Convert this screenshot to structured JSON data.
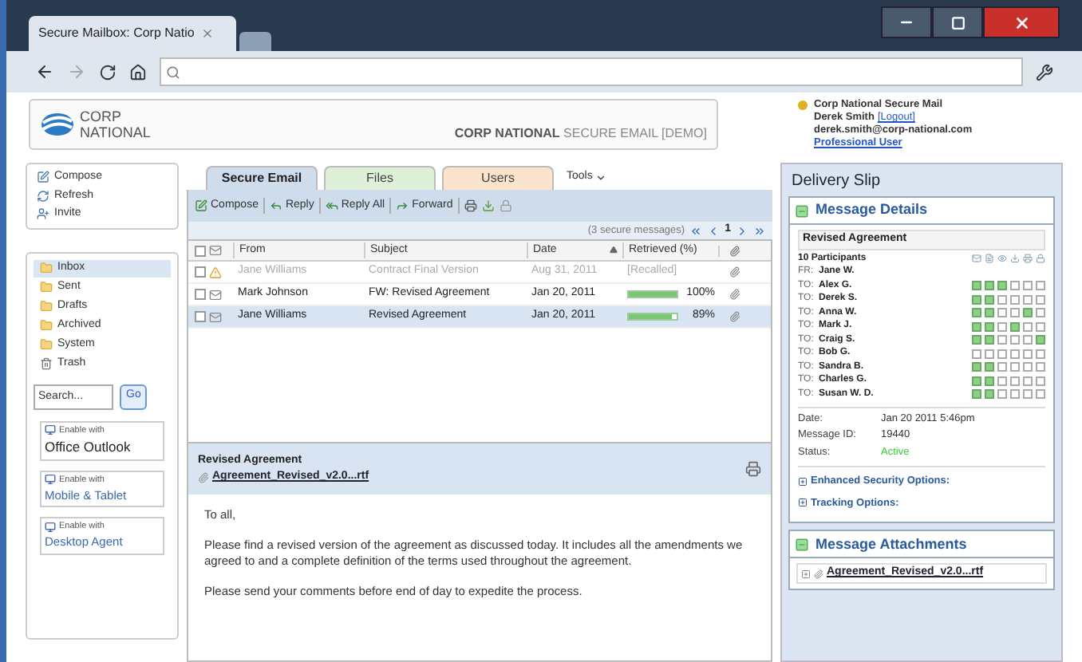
{
  "browser": {
    "tab_title": "Secure Mailbox: Corp Natio"
  },
  "header": {
    "logo_line1": "CORP",
    "logo_line2": "NATIONAL",
    "product_bold": "CORP NATIONAL",
    "product_rest": "SECURE EMAIL [DEMO]",
    "service": "Corp National Secure Mail",
    "user": "Derek Smith",
    "logout": "[Logout]",
    "email": "derek.smith@corp-national.com",
    "plan": "Professional User"
  },
  "actions": [
    {
      "label": "Compose"
    },
    {
      "label": "Refresh"
    },
    {
      "label": "Invite"
    }
  ],
  "folders": [
    {
      "label": "Inbox",
      "selected": true
    },
    {
      "label": "Sent",
      "selected": false
    },
    {
      "label": "Drafts",
      "selected": false
    },
    {
      "label": "Archived",
      "selected": false
    },
    {
      "label": "System",
      "selected": false
    },
    {
      "label": "Trash",
      "selected": false
    }
  ],
  "search": {
    "placeholder": "Search...",
    "button": "Go"
  },
  "enable_badges": [
    {
      "caption": "Enable with",
      "product": "Office Outlook"
    },
    {
      "caption": "Enable with",
      "product": "Mobile & Tablet"
    },
    {
      "caption": "Enable with",
      "product": "Desktop Agent"
    }
  ],
  "tabs": [
    {
      "label": "Secure Email",
      "selected": true
    },
    {
      "label": "Files",
      "selected": false
    },
    {
      "label": "Users",
      "selected": false
    }
  ],
  "tools_menu": "Tools",
  "toolbar": [
    "Compose",
    "Reply",
    "Reply All",
    "Forward"
  ],
  "pager": {
    "summary": "(3 secure messages)",
    "page": "1"
  },
  "table": {
    "select_all_checked": false,
    "columns": [
      "From",
      "Subject",
      "Date",
      "Retrieved (%)"
    ],
    "rows": [
      {
        "from": "Jane Williams",
        "subject": "Contract Final Version",
        "date": "Aug 31, 2011",
        "kind": "recalled",
        "retrieved": "[Recalled]",
        "checked": false,
        "selected": false
      },
      {
        "from": "Mark Johnson",
        "subject": "FW: Revised Agreement",
        "date": "Jan 20, 2011",
        "kind": "progress",
        "level": 1,
        "retrieved": "100%",
        "checked": false,
        "selected": false
      },
      {
        "from": "Jane Williams",
        "subject": "Revised Agreement",
        "date": "Jan 20, 2011",
        "kind": "progress",
        "level": 0.89,
        "retrieved": "89%",
        "checked": false,
        "selected": true
      }
    ]
  },
  "preview": {
    "subject": "Revised Agreement",
    "attachment": "Agreement_Revised_v2.0...rtf",
    "paragraphs": [
      "To all,",
      "Please find a revised version of the agreement as discussed today. It includes all the amendments we agreed to and a complete definition of the terms used throughout the agreement.",
      "Please send your comments before end of day to expedite the process."
    ]
  },
  "delivery_slip": {
    "title": "Delivery Slip",
    "details_title": "Message Details",
    "subject": "Revised Agreement",
    "participants_count": "10 Participants",
    "participants": [
      {
        "role": "FR:",
        "name": "Jane W."
      },
      {
        "role": "TO:",
        "name": "Alex G.",
        "checks": [
          true,
          true,
          true,
          false,
          false,
          false
        ]
      },
      {
        "role": "TO:",
        "name": "Derek S.",
        "checks": [
          true,
          true,
          false,
          false,
          false,
          false
        ]
      },
      {
        "role": "TO:",
        "name": "Anna W.",
        "checks": [
          true,
          true,
          false,
          false,
          true,
          false
        ]
      },
      {
        "role": "TO:",
        "name": "Mark J.",
        "checks": [
          true,
          true,
          false,
          true,
          false,
          false
        ]
      },
      {
        "role": "TO:",
        "name": "Craig S.",
        "checks": [
          true,
          true,
          false,
          false,
          false,
          true
        ]
      },
      {
        "role": "TO:",
        "name": "Bob G.",
        "checks": [
          false,
          false,
          false,
          false,
          false,
          false
        ]
      },
      {
        "role": "TO:",
        "name": "Sandra B.",
        "checks": [
          true,
          true,
          false,
          false,
          false,
          false
        ]
      },
      {
        "role": "TO:",
        "name": "Charles G.",
        "checks": [
          true,
          true,
          false,
          false,
          false,
          false
        ]
      },
      {
        "role": "TO:",
        "name": "Susan W. D.",
        "checks": [
          true,
          true,
          false,
          false,
          false,
          false
        ]
      }
    ],
    "fields": [
      {
        "label": "Date:",
        "value": "Jan 20 2011 5:46pm",
        "kind": "plain"
      },
      {
        "label": "Message ID:",
        "value": "19440",
        "kind": "plain"
      },
      {
        "label": "Status:",
        "value": "Active",
        "kind": "status"
      }
    ],
    "options": [
      {
        "label": "Enhanced Security Options:",
        "expanded": false
      },
      {
        "label": "Tracking Options:",
        "expanded": false
      }
    ],
    "attachments_title": "Message Attachments",
    "attachments": [
      {
        "name": "Agreement_Revised_v2.0...rtf",
        "expanded": false
      }
    ]
  }
}
